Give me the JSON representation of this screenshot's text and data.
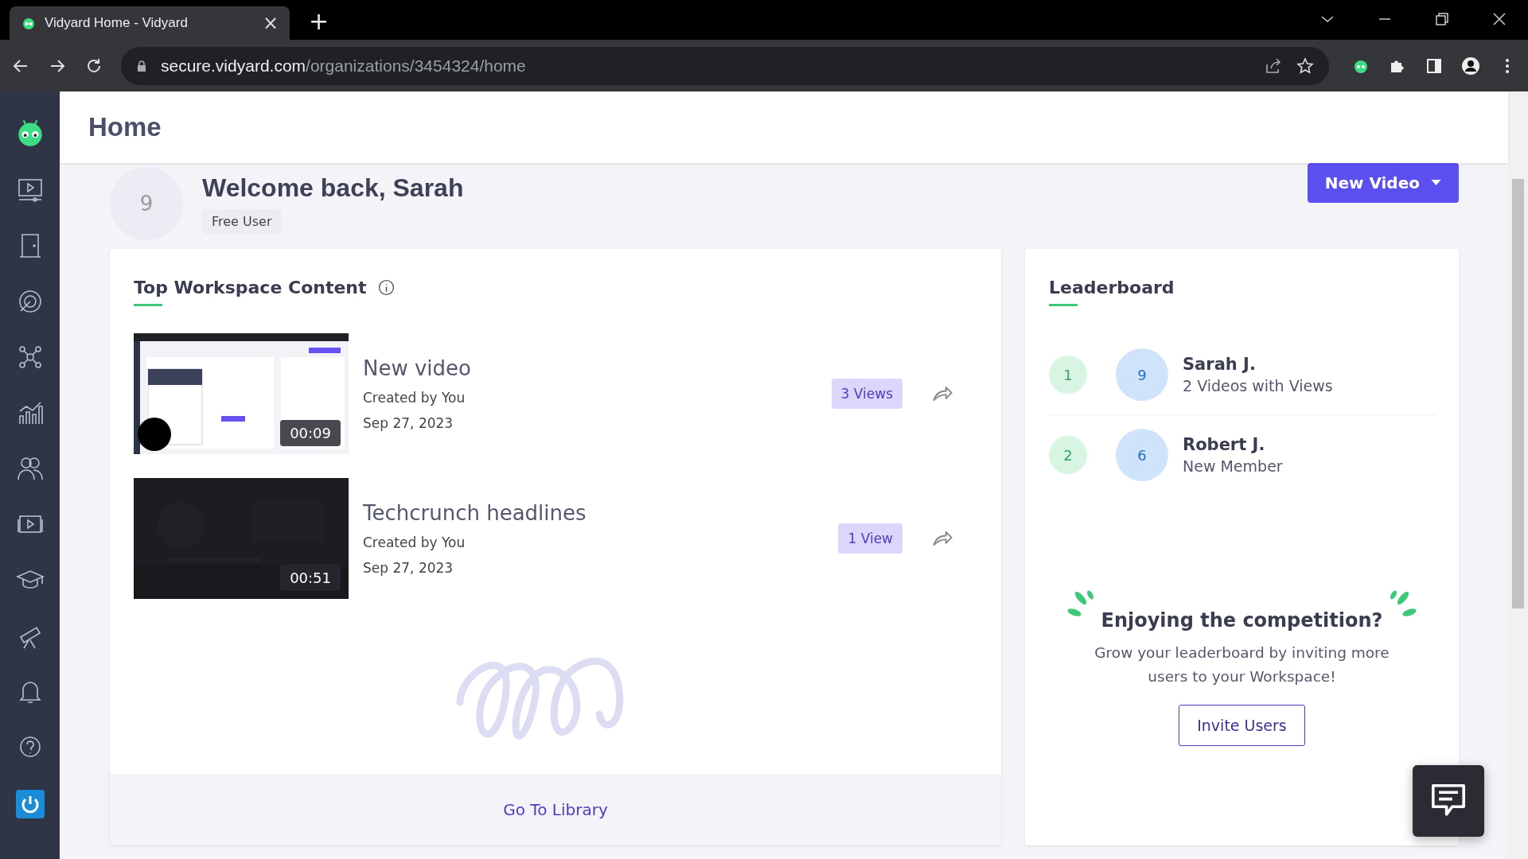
{
  "browser": {
    "tab_title": "Vidyard Home - Vidyard",
    "tab_close": "×",
    "new_tab": "+",
    "url_domain": "secure.vidyard.com",
    "url_path": "/organizations/3454324/home"
  },
  "page": {
    "title": "Home"
  },
  "welcome": {
    "avatar": "9",
    "heading": "Welcome back, Sarah",
    "badge": "Free User",
    "new_video_button": "New Video"
  },
  "top_content": {
    "title": "Top Workspace Content",
    "videos": [
      {
        "title": "New video",
        "creator": "Created by You",
        "date": "Sep 27, 2023",
        "duration": "00:09",
        "views": "3 Views"
      },
      {
        "title": "Techcrunch headlines",
        "creator": "Created by You",
        "date": "Sep 27, 2023",
        "duration": "00:51",
        "views": "1 View"
      }
    ],
    "footer_link": "Go To Library"
  },
  "leaderboard": {
    "title": "Leaderboard",
    "entries": [
      {
        "rank": "1",
        "avatar": "9",
        "name": "Sarah J.",
        "detail": "2 Videos with Views"
      },
      {
        "rank": "2",
        "avatar": "6",
        "name": "Robert J.",
        "detail": "New Member"
      }
    ],
    "promo_title": "Enjoying the competition?",
    "promo_text": "Grow your leaderboard by inviting more users to your Workspace!",
    "invite_button": "Invite Users"
  }
}
